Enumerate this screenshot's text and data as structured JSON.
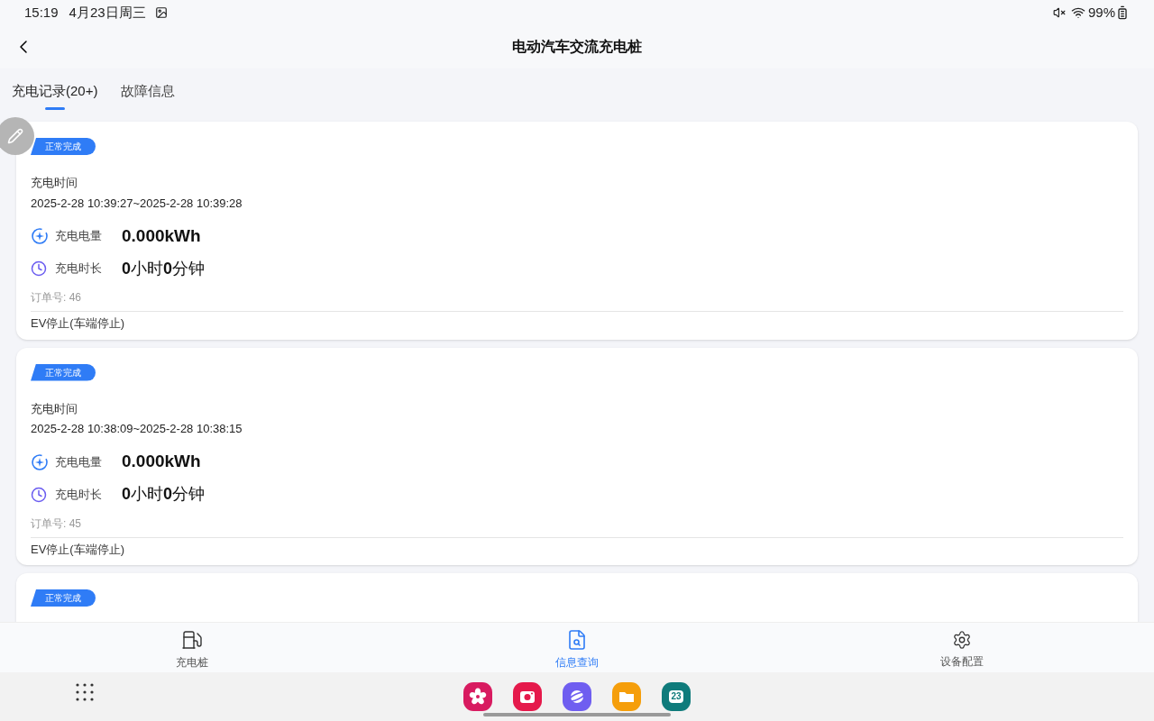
{
  "status_bar": {
    "time": "15:19",
    "date": "4月23日周三",
    "battery": "99%"
  },
  "header": {
    "title": "电动汽车交流充电桩"
  },
  "tabs": [
    {
      "label": "充电记录(20+)",
      "selected": true
    },
    {
      "label": "故障信息",
      "selected": false
    }
  ],
  "records": [
    {
      "status": "正常完成",
      "time_label": "充电时间",
      "time_range": "2025-2-28 10:39:27~2025-2-28 10:39:28",
      "energy_label": "充电电量",
      "energy": "0.000kWh",
      "duration_label": "充电时长",
      "duration": "**0**小时**0**分钟",
      "order": "订单号: 46",
      "stop_reason": "EV停止(车端停止)"
    },
    {
      "status": "正常完成",
      "time_label": "充电时间",
      "time_range": "2025-2-28 10:38:09~2025-2-28 10:38:15",
      "energy_label": "充电电量",
      "energy": "0.000kWh",
      "duration_label": "充电时长",
      "duration": "**0**小时**0**分钟",
      "order": "订单号: 45",
      "stop_reason": "EV停止(车端停止)"
    },
    {
      "status": "正常完成"
    }
  ],
  "bottom_nav": [
    {
      "kind": "charger",
      "label": "充电桩",
      "selected": false
    },
    {
      "kind": "query",
      "label": "信息查询",
      "selected": true
    },
    {
      "kind": "settings",
      "label": "设备配置",
      "selected": false
    }
  ],
  "dock": [
    {
      "kind": "flower",
      "color": "#d81b60"
    },
    {
      "kind": "camera",
      "color": "#e5194b"
    },
    {
      "kind": "planet",
      "color": "#6f5ef0"
    },
    {
      "kind": "folder",
      "color": "#f59e0b"
    },
    {
      "kind": "calendar",
      "color": "#0f7b7b",
      "text": "23"
    }
  ]
}
